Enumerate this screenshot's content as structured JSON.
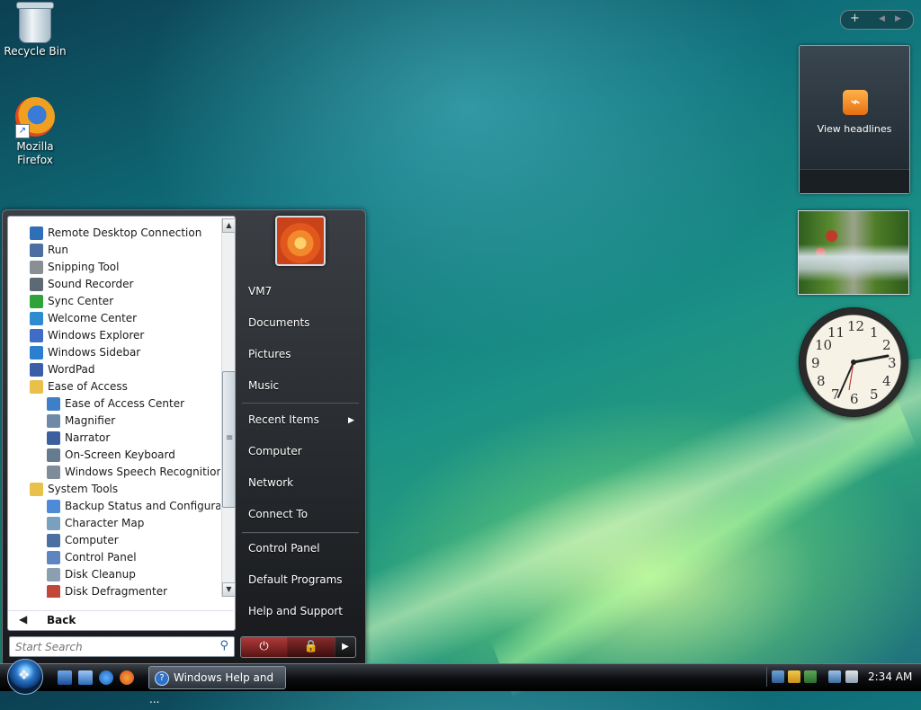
{
  "desktop": {
    "icons": [
      {
        "label": "Recycle Bin"
      },
      {
        "label": "Mozilla\nFirefox"
      }
    ]
  },
  "sidebar": {
    "controls": {
      "add": "+",
      "prev": "◀",
      "next": "▶"
    },
    "feed": {
      "label": "View headlines"
    }
  },
  "clock_gadget": {
    "numerals": [
      "12",
      "1",
      "2",
      "3",
      "4",
      "5",
      "6",
      "7",
      "8",
      "9",
      "10",
      "11"
    ]
  },
  "start_menu": {
    "programs": [
      {
        "label": "Remote Desktop Connection",
        "indent": 0,
        "icon": "remote-desktop-icon"
      },
      {
        "label": "Run",
        "indent": 0,
        "icon": "run-icon"
      },
      {
        "label": "Snipping Tool",
        "indent": 0,
        "icon": "scissors-icon"
      },
      {
        "label": "Sound Recorder",
        "indent": 0,
        "icon": "microphone-icon"
      },
      {
        "label": "Sync Center",
        "indent": 0,
        "icon": "sync-icon"
      },
      {
        "label": "Welcome Center",
        "indent": 0,
        "icon": "welcome-icon"
      },
      {
        "label": "Windows Explorer",
        "indent": 0,
        "icon": "explorer-icon"
      },
      {
        "label": "Windows Sidebar",
        "indent": 0,
        "icon": "sidebar-icon"
      },
      {
        "label": "WordPad",
        "indent": 0,
        "icon": "wordpad-icon"
      },
      {
        "label": "Ease of Access",
        "indent": 0,
        "icon": "folder-icon"
      },
      {
        "label": "Ease of Access Center",
        "indent": 1,
        "icon": "ease-of-access-icon"
      },
      {
        "label": "Magnifier",
        "indent": 1,
        "icon": "magnifier-icon"
      },
      {
        "label": "Narrator",
        "indent": 1,
        "icon": "narrator-icon"
      },
      {
        "label": "On-Screen Keyboard",
        "indent": 1,
        "icon": "keyboard-icon"
      },
      {
        "label": "Windows Speech Recognition",
        "indent": 1,
        "icon": "speech-icon"
      },
      {
        "label": "System Tools",
        "indent": 0,
        "icon": "folder-icon"
      },
      {
        "label": "Backup Status and Configuration",
        "indent": 1,
        "icon": "backup-icon"
      },
      {
        "label": "Character Map",
        "indent": 1,
        "icon": "character-map-icon"
      },
      {
        "label": "Computer",
        "indent": 1,
        "icon": "computer-icon"
      },
      {
        "label": "Control Panel",
        "indent": 1,
        "icon": "control-panel-icon"
      },
      {
        "label": "Disk Cleanup",
        "indent": 1,
        "icon": "disk-cleanup-icon"
      },
      {
        "label": "Disk Defragmenter",
        "indent": 1,
        "icon": "defragmenter-icon"
      }
    ],
    "back_label": "Back",
    "search_placeholder": "Start Search",
    "right_items": [
      {
        "label": "VM7"
      },
      {
        "label": "Documents"
      },
      {
        "label": "Pictures"
      },
      {
        "label": "Music"
      },
      {
        "label": "Recent Items"
      },
      {
        "label": "Computer"
      },
      {
        "label": "Network"
      },
      {
        "label": "Connect To"
      },
      {
        "label": "Control Panel"
      },
      {
        "label": "Default Programs"
      },
      {
        "label": "Help and Support"
      }
    ]
  },
  "taskbar": {
    "task_button_label": "Windows Help and ...",
    "clock": "2:34 AM"
  },
  "colors": {
    "accent": "#2e72c9",
    "power_red": "#b13a3a"
  }
}
